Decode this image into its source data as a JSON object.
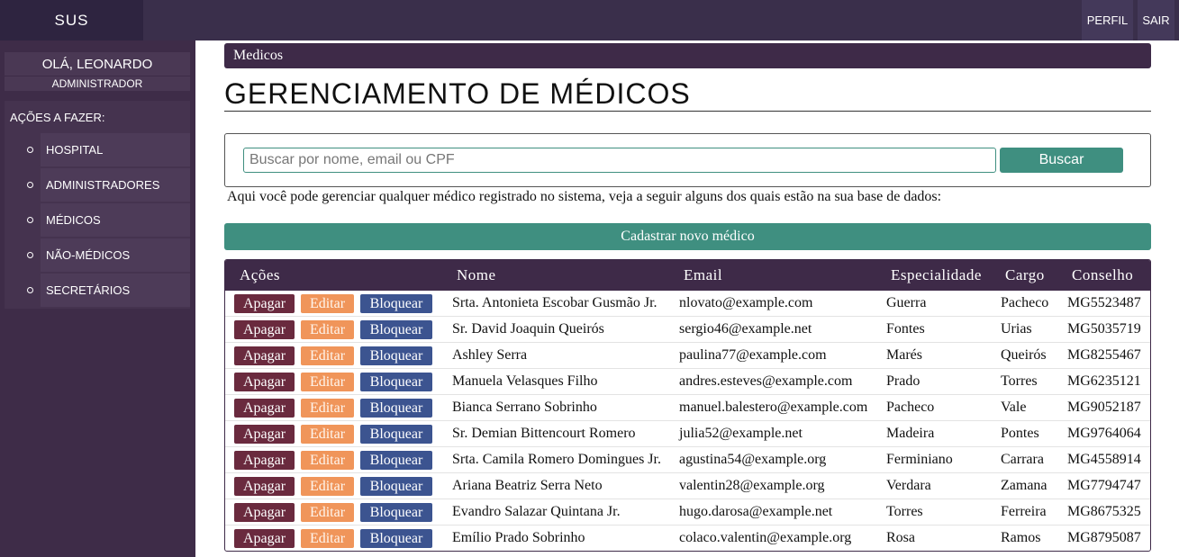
{
  "header": {
    "brand": "SUS",
    "nav": {
      "perfil": "PERFIL",
      "sair": "SAIR"
    }
  },
  "sidebar": {
    "greeting": "OLÁ, LEONARDO",
    "role": "ADMINISTRADOR",
    "actions_title": "AÇÕES A FAZER:",
    "items": [
      {
        "label": "HOSPITAL"
      },
      {
        "label": "ADMINISTRADORES"
      },
      {
        "label": "MÉDICOS"
      },
      {
        "label": "NÃO-MÉDICOS"
      },
      {
        "label": "SECRETÁRIOS"
      }
    ]
  },
  "main": {
    "breadcrumb": "Medicos",
    "title": "GERENCIAMENTO DE MÉDICOS",
    "search": {
      "placeholder": "Buscar por nome, email ou CPF",
      "value": "",
      "button": "Buscar"
    },
    "description": "Aqui você pode gerenciar qualquer médico registrado no sistema, veja a seguir alguns dos quais estão na sua base de dados:",
    "new_button": "Cadastrar novo médico",
    "table": {
      "headers": {
        "acoes": "Ações",
        "nome": "Nome",
        "email": "Email",
        "especialidade": "Especialidade",
        "cargo": "Cargo",
        "conselho": "Conselho"
      },
      "action_labels": {
        "apagar": "Apagar",
        "editar": "Editar",
        "bloquear": "Bloquear"
      },
      "rows": [
        {
          "nome": "Srta. Antonieta Escobar Gusmão Jr.",
          "email": "nlovato@example.com",
          "especialidade": "Guerra",
          "cargo": "Pacheco",
          "conselho": "MG5523487"
        },
        {
          "nome": "Sr. David Joaquin Queirós",
          "email": "sergio46@example.net",
          "especialidade": "Fontes",
          "cargo": "Urias",
          "conselho": "MG5035719"
        },
        {
          "nome": "Ashley Serra",
          "email": "paulina77@example.com",
          "especialidade": "Marés",
          "cargo": "Queirós",
          "conselho": "MG8255467"
        },
        {
          "nome": "Manuela Velasques Filho",
          "email": "andres.esteves@example.com",
          "especialidade": "Prado",
          "cargo": "Torres",
          "conselho": "MG6235121"
        },
        {
          "nome": "Bianca Serrano Sobrinho",
          "email": "manuel.balestero@example.com",
          "especialidade": "Pacheco",
          "cargo": "Vale",
          "conselho": "MG9052187"
        },
        {
          "nome": "Sr. Demian Bittencourt Romero",
          "email": "julia52@example.net",
          "especialidade": "Madeira",
          "cargo": "Pontes",
          "conselho": "MG9764064"
        },
        {
          "nome": "Srta. Camila Romero Domingues Jr.",
          "email": "agustina54@example.org",
          "especialidade": "Ferminiano",
          "cargo": "Carrara",
          "conselho": "MG4558914"
        },
        {
          "nome": "Ariana Beatriz Serra Neto",
          "email": "valentin28@example.org",
          "especialidade": "Verdara",
          "cargo": "Zamana",
          "conselho": "MG7794747"
        },
        {
          "nome": "Evandro Salazar Quintana Jr.",
          "email": "hugo.darosa@example.net",
          "especialidade": "Torres",
          "cargo": "Ferreira",
          "conselho": "MG8675325"
        },
        {
          "nome": "Emílio Prado Sobrinho",
          "email": "colaco.valentin@example.org",
          "especialidade": "Rosa",
          "cargo": "Ramos",
          "conselho": "MG8795087"
        }
      ]
    }
  },
  "colors": {
    "topbar": "#3a2f4b",
    "sidebar": "#3e2c48",
    "accent_teal": "#3f8f80",
    "btn_apagar": "#6a2a3e",
    "btn_editar": "#f0955a",
    "btn_bloquear": "#3c5490"
  }
}
